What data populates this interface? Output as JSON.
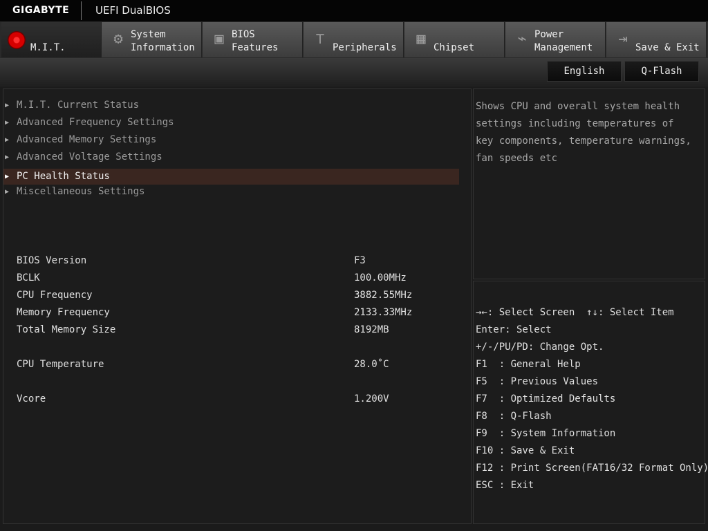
{
  "header": {
    "brand": "GIGABYTE",
    "product": "UEFI DualBIOS"
  },
  "tabs": [
    {
      "line1": "",
      "line2": "M.I.T.",
      "icon": "mit-icon",
      "active": true
    },
    {
      "line1": "System",
      "line2": "Information",
      "icon": "gear-icon"
    },
    {
      "line1": "BIOS",
      "line2": "Features",
      "icon": "chip-icon"
    },
    {
      "line1": "",
      "line2": "Peripherals",
      "icon": "plug-icon"
    },
    {
      "line1": "",
      "line2": "Chipset",
      "icon": "chipset-icon"
    },
    {
      "line1": "Power",
      "line2": "Management",
      "icon": "power-icon"
    },
    {
      "line1": "",
      "line2": "Save & Exit",
      "icon": "exit-icon"
    }
  ],
  "subbar": {
    "language": "English",
    "qflash": "Q-Flash"
  },
  "menu": [
    "M.I.T. Current Status",
    "Advanced Frequency Settings",
    "Advanced Memory Settings",
    "Advanced Voltage Settings",
    "PC Health Status",
    "Miscellaneous Settings"
  ],
  "selected_index": 4,
  "info": [
    {
      "label": "BIOS Version",
      "value": "F3"
    },
    {
      "label": "BCLK",
      "value": "100.00MHz"
    },
    {
      "label": "CPU Frequency",
      "value": "3882.55MHz"
    },
    {
      "label": "Memory Frequency",
      "value": "2133.33MHz"
    },
    {
      "label": "Total Memory Size",
      "value": "8192MB"
    },
    {
      "label": "CPU Temperature",
      "value": "28.0˚C"
    },
    {
      "label": "Vcore",
      "value": "1.200V"
    }
  ],
  "help": "Shows CPU and overall system health settings including temperatures of key components, temperature warnings, fan speeds etc",
  "keys": [
    "→←: Select Screen  ↑↓: Select Item",
    "Enter: Select",
    "+/-/PU/PD: Change Opt.",
    "F1  : General Help",
    "F5  : Previous Values",
    "F7  : Optimized Defaults",
    "F8  : Q-Flash",
    "F9  : System Information",
    "F10 : Save & Exit",
    "F12 : Print Screen(FAT16/32 Format Only)",
    "ESC : Exit"
  ]
}
